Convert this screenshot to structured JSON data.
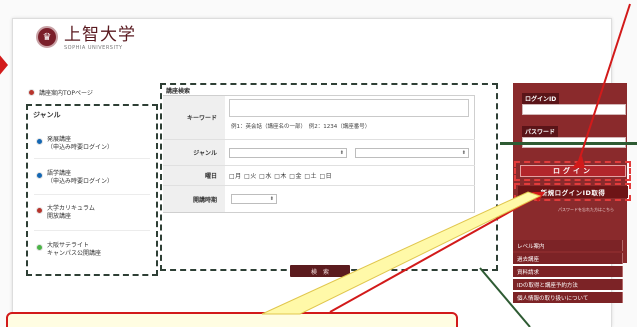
{
  "header": {
    "logo_glyph": "♛",
    "title": "上智大学",
    "subtitle": "SOPHIA UNIVERSITY"
  },
  "sidebar": {
    "top_link": "講座案内TOPページ",
    "genre_title": "ジャンル",
    "items": [
      {
        "line1": "発展講座",
        "line2": "（申込み時要ログイン）",
        "color": "#1467b3"
      },
      {
        "line1": "語学講座",
        "line2": "（申込み時要ログイン）",
        "color": "#1467b3"
      },
      {
        "line1": "大学カリキュラム",
        "line2": "開放講座",
        "color": "#b7342c"
      },
      {
        "line1": "大阪サテライト",
        "line2": "キャンパス公開講座",
        "color": "#4bb447"
      }
    ]
  },
  "search": {
    "title": "講座検索",
    "keyword_label": "キーワード",
    "keyword_hint": "例1：英会話（講座名の一部）　例2：1234（講座番号）",
    "genre_label": "ジャンル",
    "weekday_label": "曜日",
    "weekdays": "□月 □火 □水 □木 □金 □土 □日",
    "period_label": "開講時期",
    "button": "検　索"
  },
  "login": {
    "id_label": "ログインID",
    "pw_label": "パスワード",
    "login_button": "ログイン",
    "register_button": "新規ログインID取得",
    "forgot": "パスワードを忘れた方はこちら"
  },
  "menu": [
    "レベル案内",
    "過去講座",
    "資料請求",
    "IDの取得と講座予約方法",
    "個人情報の取り扱いについて"
  ],
  "colors": {
    "brand": "#7a1f2a",
    "callout": "#d21a1a",
    "dashed": "#2e3f35"
  }
}
